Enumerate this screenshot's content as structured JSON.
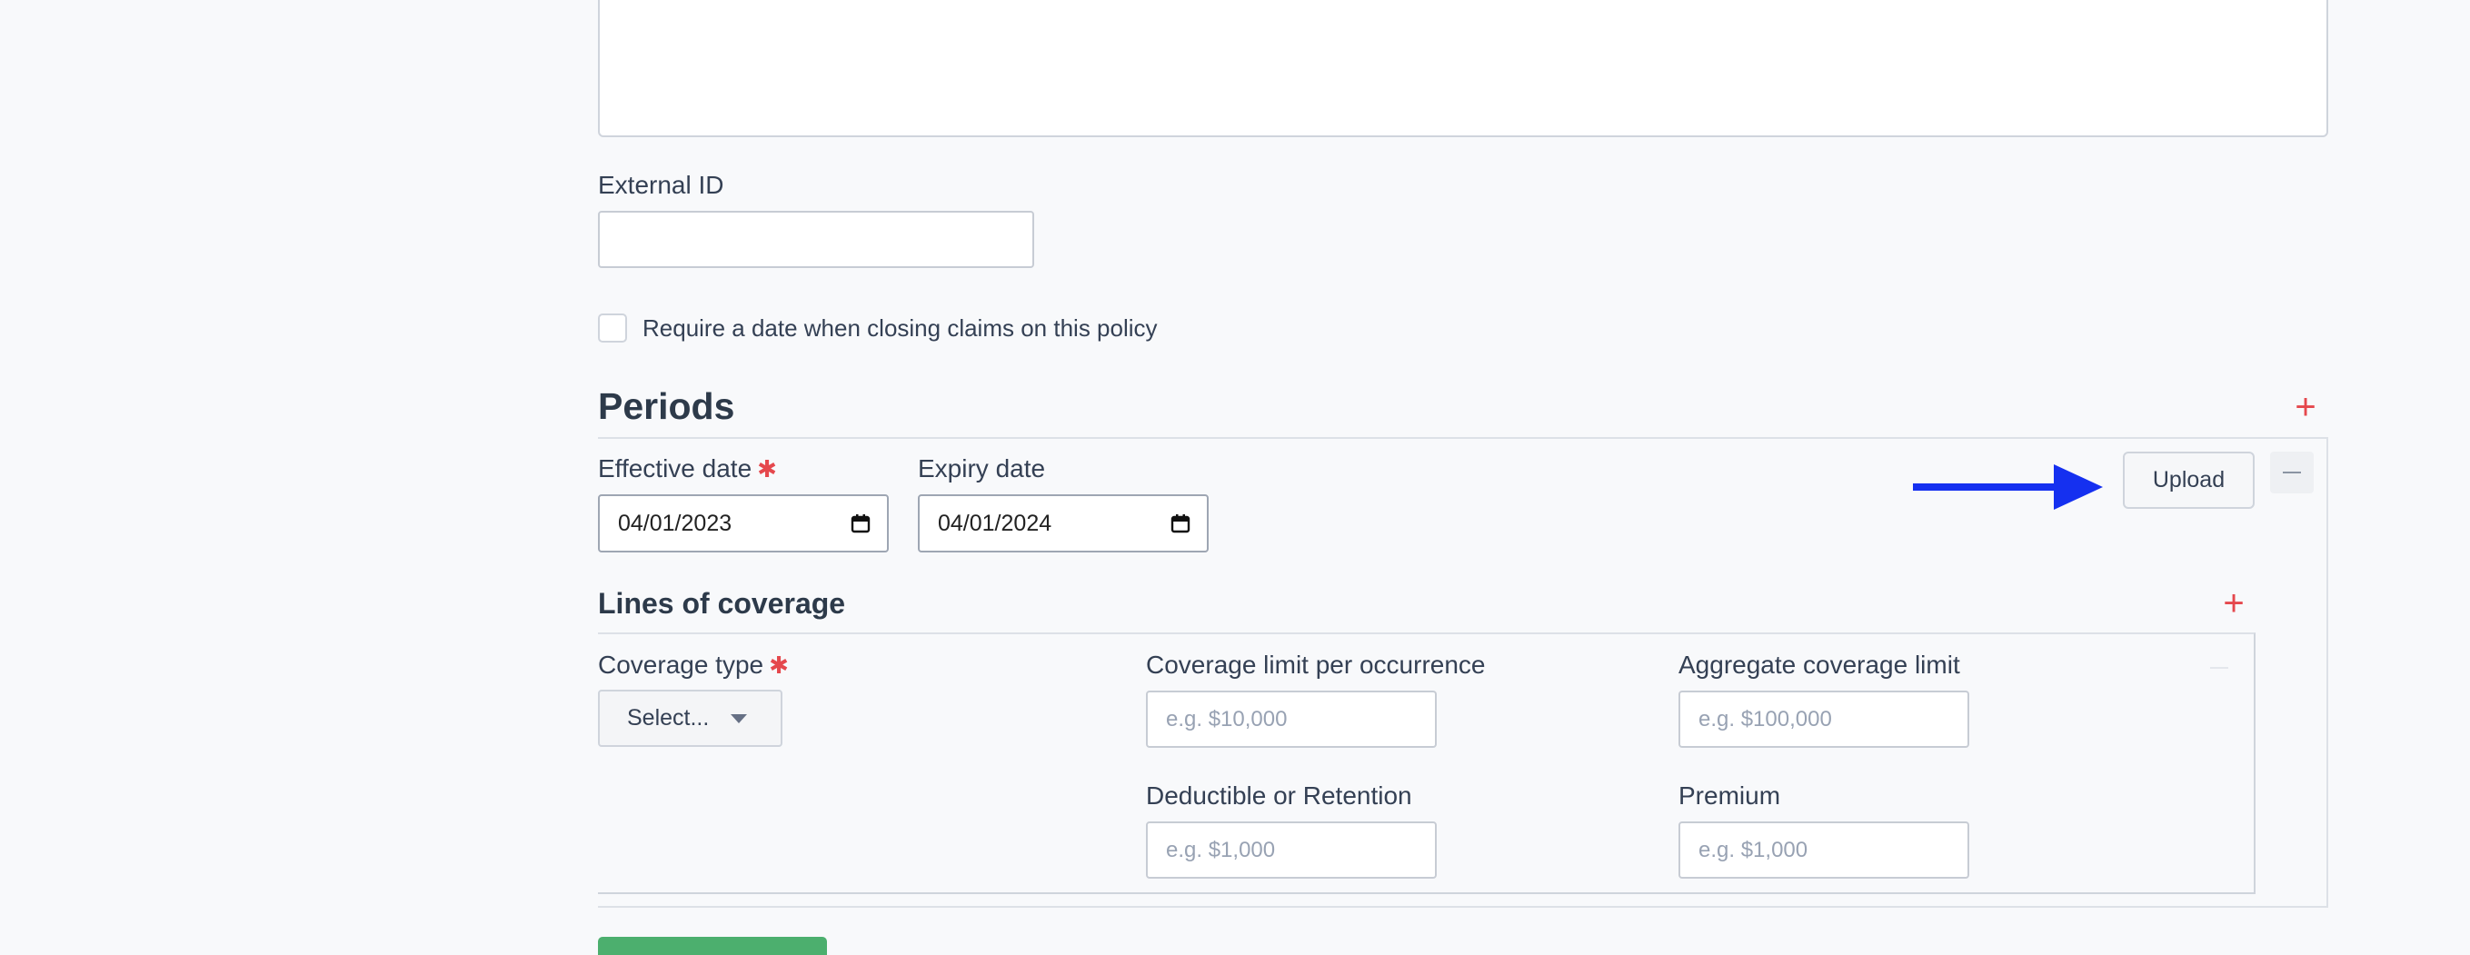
{
  "external_id": {
    "label": "External ID",
    "value": ""
  },
  "require_date": {
    "label": "Require a date when closing claims on this policy",
    "checked": false
  },
  "periods": {
    "title": "Periods",
    "add_icon": "plus-icon",
    "effective_date": {
      "label": "Effective date",
      "required_mark": "✱",
      "value": "04/01/2023"
    },
    "expiry_date": {
      "label": "Expiry date",
      "value": "04/01/2024"
    },
    "upload_label": "Upload",
    "remove_icon": "minus-icon"
  },
  "lines_of_coverage": {
    "title": "Lines of coverage",
    "coverage_type": {
      "label": "Coverage type",
      "required_mark": "✱",
      "select_value": "Select..."
    },
    "coverage_limit": {
      "label": "Coverage limit per occurrence",
      "placeholder": "e.g. $10,000"
    },
    "aggregate_limit": {
      "label": "Aggregate coverage limit",
      "placeholder": "e.g. $100,000"
    },
    "deductible": {
      "label": "Deductible or Retention",
      "placeholder": "e.g. $1,000"
    },
    "premium": {
      "label": "Premium",
      "placeholder": "e.g. $1,000"
    }
  },
  "annotation": {
    "arrow_color": "#1530f0",
    "points_to": "Upload"
  },
  "colors": {
    "required": "#e5484d",
    "add": "#e5484d",
    "primary_green": "#4caf6e"
  }
}
